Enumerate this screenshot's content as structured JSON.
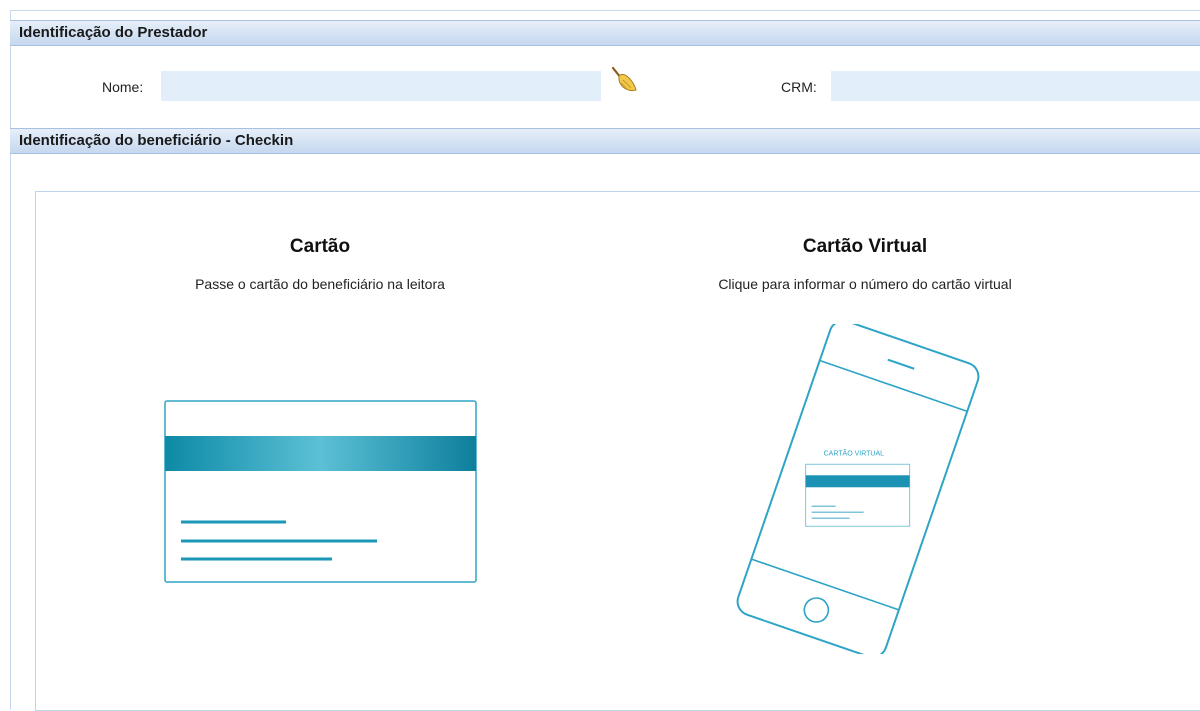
{
  "prestador": {
    "header": "Identificação do Prestador",
    "nome_label": "Nome:",
    "nome_value": "",
    "crm_label": "CRM:",
    "crm_value": "",
    "clear_icon": "broom-icon"
  },
  "beneficiario": {
    "header": "Identificação do beneficiário - Checkin",
    "cartao": {
      "title": "Cartão",
      "subtitle": "Passe o cartão do beneficiário na leitora"
    },
    "virtual": {
      "title": "Cartão Virtual",
      "subtitle": "Clique para informar o número do cartão virtual",
      "phone_screen_label": "CARTÃO VIRTUAL"
    }
  },
  "colors": {
    "accent": "#2ea4c7",
    "card_stripe_dark": "#0d8aa6",
    "card_stripe_light": "#5cc0d6"
  }
}
